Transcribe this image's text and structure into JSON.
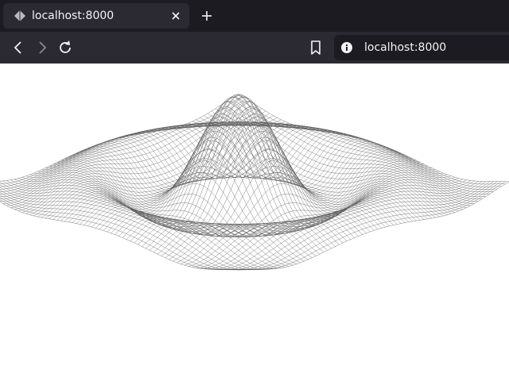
{
  "tab": {
    "title": "localhost:8000",
    "favicon_icon": "diamond-globe-icon",
    "close_icon": "close-icon"
  },
  "new_tab_icon": "plus-icon",
  "toolbar": {
    "back_icon": "chevron-left-icon",
    "forward_icon": "chevron-right-icon",
    "reload_icon": "reload-icon",
    "bookmark_icon": "bookmark-icon",
    "site_info_icon": "info-icon",
    "url": "localhost:8000"
  },
  "colors": {
    "chrome_dark": "#1c1b22",
    "chrome_mid": "#2b2a33",
    "chrome_text": "#f3f3f3",
    "mesh_line": "#5a5a5a",
    "page_background": "#ffffff"
  },
  "content": {
    "visualization": "wireframe-surface-mesh"
  }
}
